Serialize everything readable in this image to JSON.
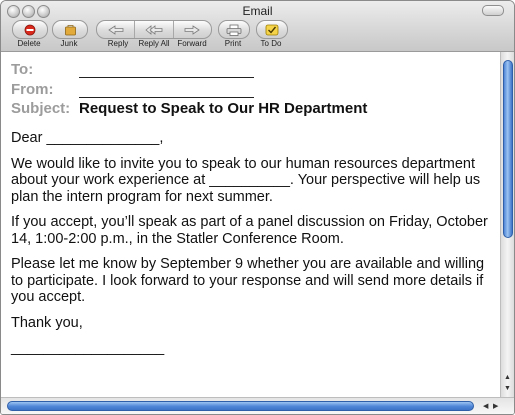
{
  "window": {
    "title": "Email"
  },
  "toolbar": {
    "delete_label": "Delete",
    "junk_label": "Junk",
    "reply_label": "Reply",
    "reply_all_label": "Reply All",
    "forward_label": "Forward",
    "print_label": "Print",
    "todo_label": "To Do",
    "colors": {
      "delete": "#d9291c",
      "junk": "#d9a233",
      "todo": "#e0b400"
    }
  },
  "headers": {
    "to_label": "To:",
    "from_label": "From:",
    "subject_label": "Subject:",
    "subject_value": "Request to Speak to Our HR Department"
  },
  "message": {
    "salutation": "Dear ______________,",
    "paragraph1": "We would like to invite you to speak to our human resources department about your work experience at __________. Your perspective will help us plan the intern program for next summer.",
    "paragraph2": "If you accept, you’ll speak as part of a panel discussion on Friday, October 14, 1:00-2:00 p.m., in the Statler Conference Room.",
    "paragraph3": "Please let me know by September 9 whether you are available and willing to participate. I look forward to your response and will send more details if you accept.",
    "closing": "Thank you,",
    "signature": "___________________"
  }
}
